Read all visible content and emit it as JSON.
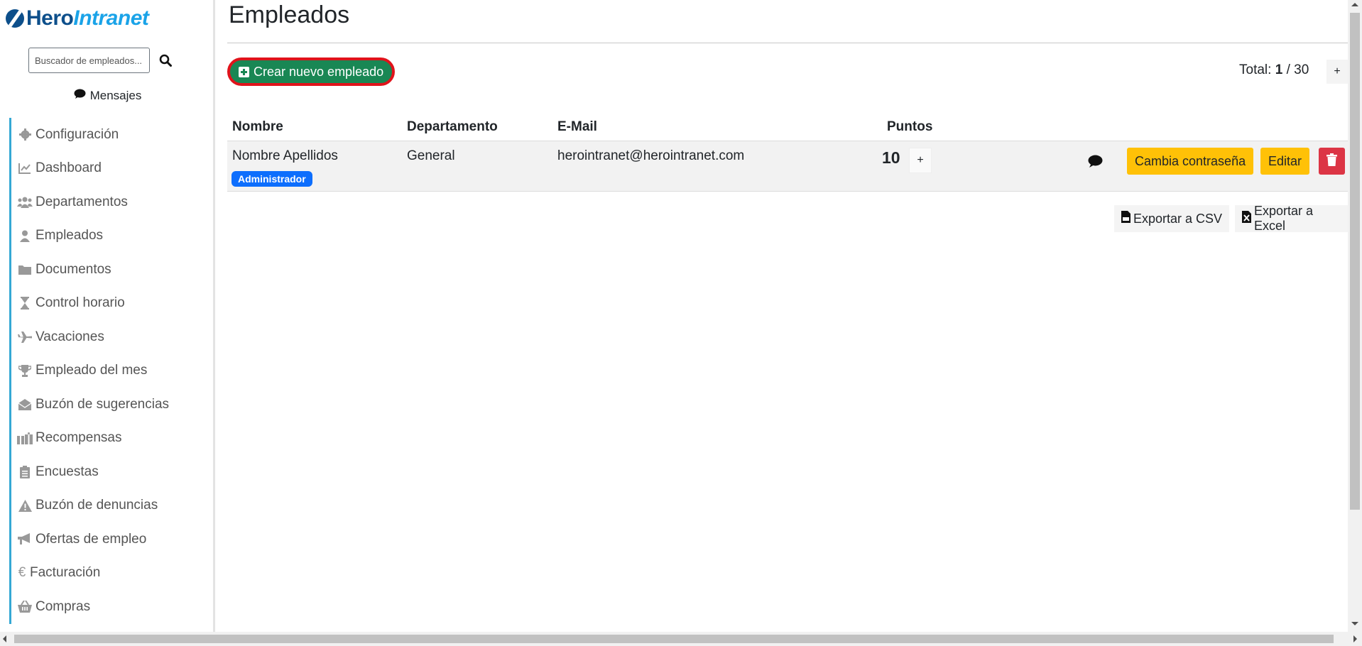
{
  "logo": {
    "hero": "Hero",
    "intranet": "Intranet"
  },
  "sidebar": {
    "search_placeholder": "Buscador de empleados...",
    "messages_label": "Mensajes",
    "items": [
      {
        "label": "Configuración",
        "icon": "gear-icon"
      },
      {
        "label": "Dashboard",
        "icon": "chart-line-icon"
      },
      {
        "label": "Departamentos",
        "icon": "users-icon"
      },
      {
        "label": "Empleados",
        "icon": "user-icon"
      },
      {
        "label": "Documentos",
        "icon": "folder-icon"
      },
      {
        "label": "Control horario",
        "icon": "hourglass-icon"
      },
      {
        "label": "Vacaciones",
        "icon": "plane-icon"
      },
      {
        "label": "Empleado del mes",
        "icon": "trophy-icon"
      },
      {
        "label": "Buzón de sugerencias",
        "icon": "envelope-open-icon"
      },
      {
        "label": "Recompensas",
        "icon": "gifts-icon"
      },
      {
        "label": "Encuestas",
        "icon": "clipboard-list-icon"
      },
      {
        "label": "Buzón de denuncias",
        "icon": "warning-icon"
      },
      {
        "label": "Ofertas de empleo",
        "icon": "bullhorn-icon"
      },
      {
        "label": "Facturación",
        "icon": "euro-icon"
      },
      {
        "label": "Compras",
        "icon": "basket-icon"
      }
    ]
  },
  "main": {
    "title": "Empleados",
    "create_button": "Crear nuevo empleado",
    "total_label": "Total:",
    "total_current": "1",
    "total_separator": "/",
    "total_max": "30",
    "total_plus": "+",
    "table": {
      "headers": [
        "Nombre",
        "Departamento",
        "E-Mail",
        "Puntos"
      ],
      "rows": [
        {
          "name": "Nombre Apellidos",
          "role_badge": "Administrador",
          "department": "General",
          "email": "herointranet@herointranet.com",
          "points": "10",
          "points_plus": "+",
          "change_password": "Cambia contraseña",
          "edit": "Editar"
        }
      ]
    },
    "export_csv": "Exportar a CSV",
    "export_excel": "Exportar a Excel"
  },
  "colors": {
    "primary_green": "#198754",
    "highlight_red": "#e0131b",
    "warning_yellow": "#ffc107",
    "danger_red": "#dc3545",
    "badge_blue": "#0d6efd",
    "nav_accent": "#35a8d4"
  }
}
